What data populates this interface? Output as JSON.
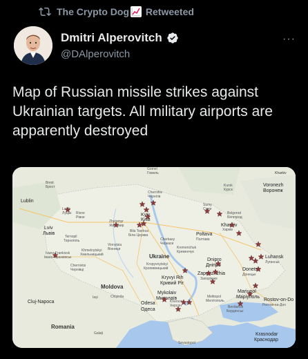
{
  "retweet": {
    "user": "The Crypto Dog",
    "emoji_icon": "chart-increasing-icon",
    "label": "Retweeted"
  },
  "author": {
    "name": "Dmitri Alperovitch",
    "handle": "@DAlperovitch",
    "verified": true
  },
  "tweet": {
    "text": "Map of Russian missile strikes against Ukrainian targets. All military airports are apparently destroyed"
  },
  "colors": {
    "background": "#000000",
    "text": "#e7e9ea",
    "muted": "#8b98a5",
    "land": "#e9eadf",
    "water": "#a7c8ec",
    "strike_marker": "#8a3e3e"
  },
  "map": {
    "labels": {
      "brest": "Brest",
      "brest_ru": "Брест",
      "gomel": "Gomel",
      "gomel_ru": "Гомель",
      "chernihiv": "Chernihiv",
      "chernihiv_ru": "Чернігів",
      "kursk": "Kursk",
      "kursk_ru": "Курск",
      "voronezh": "Voronezh",
      "voronezh_ru": "Воронеж",
      "lublin": "Lublin",
      "lutsk": "Lutsk",
      "lutsk_ru": "Луцьк",
      "rivne": "Rivne",
      "rivne_ru": "Рівне",
      "sumy": "Sumy",
      "sumy_ru": "Суми",
      "belgorod": "Belgorod",
      "belgorod_ru": "Белгород",
      "zhytomyr": "Zhytomyr",
      "zhytomyr_ru": "Житомир",
      "kyiv": "Kyiv",
      "kyiv_ru": "Київ",
      "lviv": "Lviv",
      "lviv_ru": "Львів",
      "ternopil": "Ternopil",
      "ternopil_ru": "Тернопіль",
      "bila_tserkva": "Bila Tserkva",
      "bila_tserkva_ru": "Біла Церква",
      "kharkiv": "Kharkiv",
      "kharkiv_ru": "Харків",
      "poltava": "Poltava",
      "poltava_ru": "Полтава",
      "vinnytsia": "Vinnytsia",
      "vinnytsia_ru": "Вінниця",
      "cherkasy": "Cherkasy",
      "cherkasy_ru": "Черкаси",
      "khmelnytskyi": "Khmelnytskyi",
      "khmelnytskyi_ru": "Хмельницький",
      "ivano_frankivsk": "Ivano-Frankivsk",
      "ivano_frankivsk_ru": "Івано-Франківськ",
      "kremenchuk": "Kremenchuk",
      "kremenchuk_ru": "Кременчук",
      "ukraine": "Ukraine",
      "luhansk": "Luhansk",
      "luhansk_ru": "Луганськ",
      "chernivtsi": "Chernivtsi",
      "chernivtsi_ru": "Чернівці",
      "dnipro": "Dnipro",
      "dnipro_ru": "Дніпро",
      "kropyvnytskyi": "Kropyvnytskyi",
      "kropyvnytskyi_ru": "Кропивницький",
      "zaporizhzhia": "Zaporizhzhia",
      "zaporizhzhia_ru": "Запоріжжя",
      "donetsk": "Donetsk",
      "donetsk_ru": "Донецьк",
      "kryvyi_rih": "Kryvyi Rih",
      "kryvyi_rih_ru": "Кривий Ріг",
      "moldova": "Moldova",
      "mykolaiv": "Mykolaiv",
      "mykolaiv_ru": "Миколаїв",
      "cluj_napoca": "Cluj-Napoca",
      "iasi": "Iași",
      "chisinau": "Chișinău",
      "odesa": "Odesa",
      "odesa_ru": "Одеса",
      "kherson": "Kherson",
      "kherson_ru": "Херсон",
      "melitopol": "Melitopol",
      "melitopol_ru": "Мелітополь",
      "mariupol": "Mariupol",
      "mariupol_ru": "Маріуполь",
      "rostov": "Rostov-on-Do",
      "rostov_ru": "Ростов-на-Дон",
      "berdiansk": "Berdiansk",
      "berdiansk_ru": "Бердянськ",
      "romania": "Romania",
      "krasnodar": "Krasnodar",
      "krasnodar_ru": "Краснодар",
      "sevastopol": "Sevastopol",
      "galati": "Galați"
    }
  }
}
